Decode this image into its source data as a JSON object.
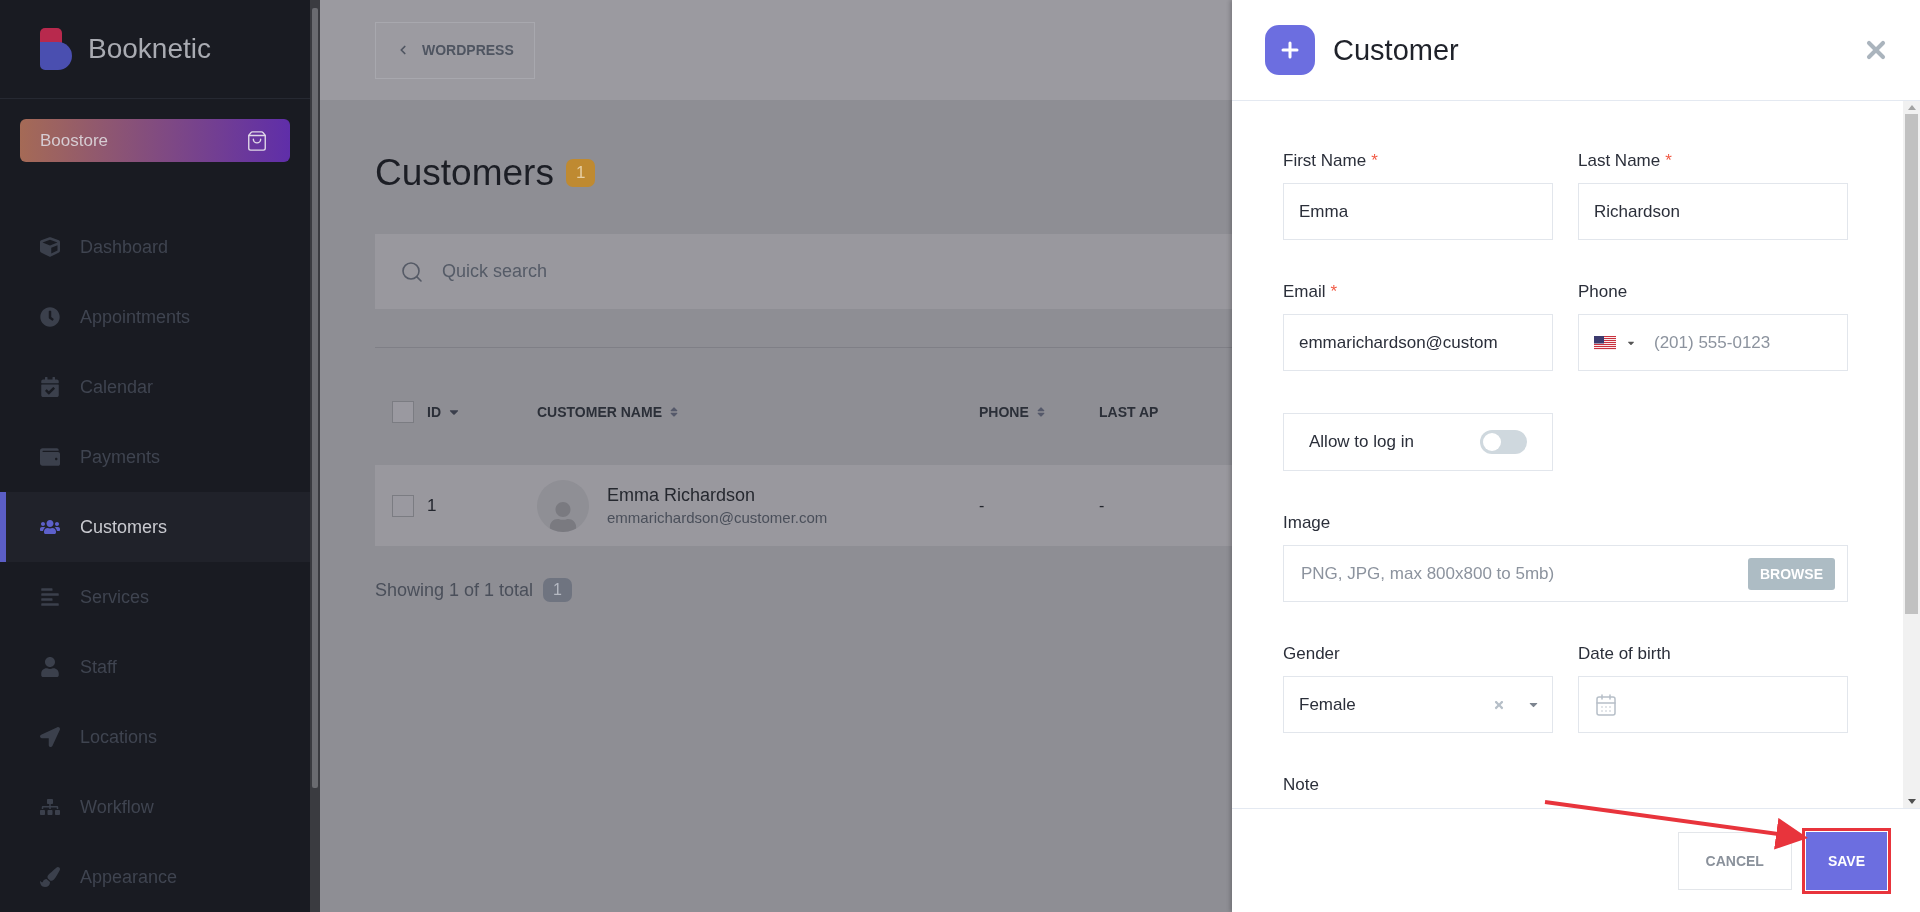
{
  "sidebar": {
    "brand": "Booknetic",
    "store": "Boostore",
    "items": [
      {
        "label": "Dashboard",
        "selected": false
      },
      {
        "label": "Appointments",
        "selected": false
      },
      {
        "label": "Calendar",
        "selected": false
      },
      {
        "label": "Payments",
        "selected": false
      },
      {
        "label": "Customers",
        "selected": true
      },
      {
        "label": "Services",
        "selected": false
      },
      {
        "label": "Staff",
        "selected": false
      },
      {
        "label": "Locations",
        "selected": false
      },
      {
        "label": "Workflow",
        "selected": false
      },
      {
        "label": "Appearance",
        "selected": false
      }
    ]
  },
  "topbar": {
    "back": "WORDPRESS"
  },
  "page": {
    "title": "Customers",
    "count": "1"
  },
  "search": {
    "placeholder": "Quick search"
  },
  "table": {
    "header_checked": false,
    "columns": [
      {
        "label": "ID",
        "sorted": true
      },
      {
        "label": "CUSTOMER NAME",
        "sorted": false
      },
      {
        "label": "PHONE",
        "sorted": false
      },
      {
        "label": "LAST AP"
      }
    ],
    "rows": [
      {
        "checked": false,
        "id": "1",
        "name": "Emma Richardson",
        "email": "emmarichardson@customer.com",
        "phone": "-",
        "column_4": "-"
      }
    ]
  },
  "pagination": {
    "text": "Showing 1 of 1 total",
    "count": "1"
  },
  "panel": {
    "title": "Customer",
    "fields": [
      {
        "kind": "text",
        "label": "First Name",
        "required_mark": "*",
        "value": "Emma"
      },
      {
        "kind": "text",
        "label": "Last Name",
        "required_mark": "*",
        "value": "Richardson"
      },
      {
        "kind": "text",
        "label": "Email",
        "required_mark": "*",
        "value": "emmarichardson@custom"
      },
      {
        "kind": "phone",
        "label": "Phone",
        "placeholder": "(201) 555-0123"
      },
      {
        "kind": "toggle",
        "label": "Allow to log in",
        "on": false
      },
      {
        "kind": "file",
        "label": "Image",
        "placeholder": "PNG, JPG, max 800x800 to 5mb)",
        "button": "BROWSE"
      },
      {
        "kind": "select",
        "label": "Gender",
        "value": "Female"
      },
      {
        "kind": "date",
        "label": "Date of birth"
      },
      {
        "kind": "note",
        "label": "Note"
      }
    ],
    "buttons": [
      {
        "kind": "secondary",
        "label": "CANCEL"
      },
      {
        "kind": "primary",
        "label": "SAVE",
        "highlighted": true
      }
    ]
  }
}
